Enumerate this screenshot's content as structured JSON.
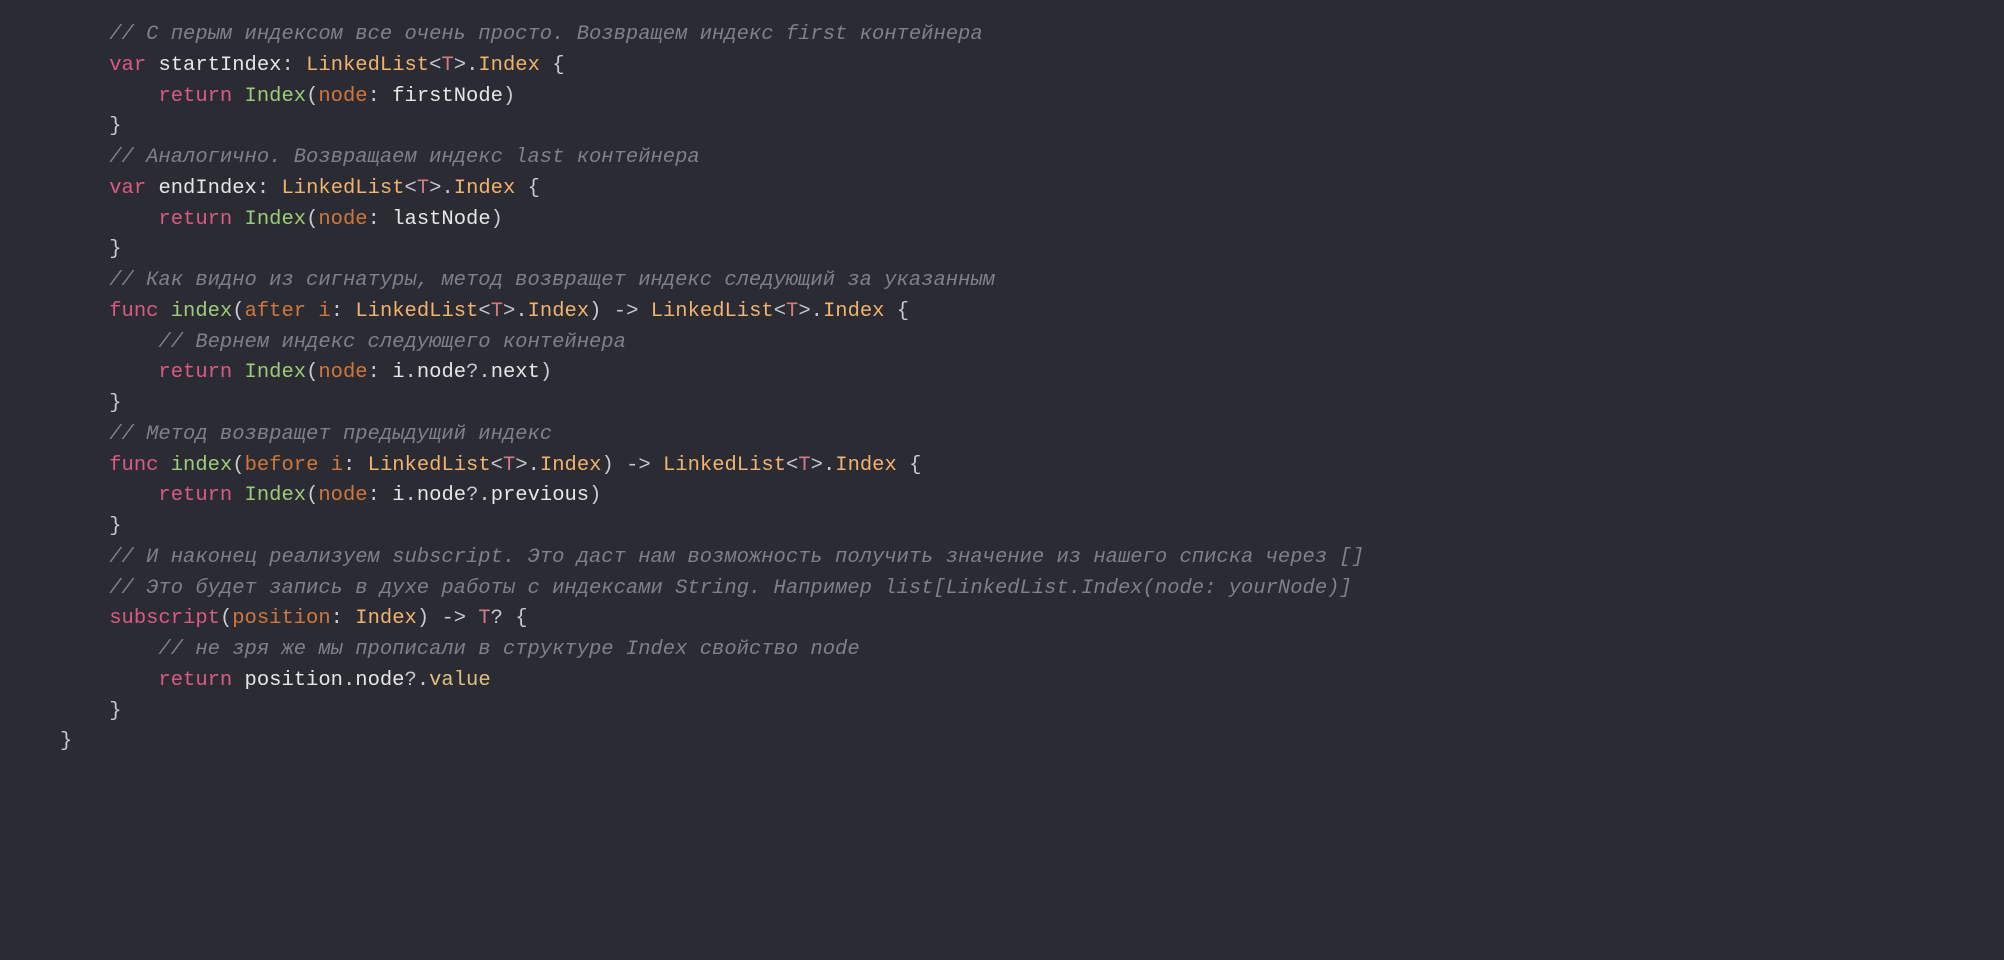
{
  "code": {
    "l1_comment": "// С перым индексом все очень просто. Возвращем индекс first контейнера",
    "l2_var": "var",
    "l2_name": "startIndex",
    "l2_colon": ":",
    "l2_type1": "LinkedList",
    "l2_lt": "<",
    "l2_T": "T",
    "l2_gt": ">",
    "l2_dot": ".",
    "l2_type2": "Index",
    "l2_brace": "{",
    "l3_return": "return",
    "l3_Index": "Index",
    "l3_open": "(",
    "l3_node": "node",
    "l3_colon": ":",
    "l3_arg": "firstNode",
    "l3_close": ")",
    "l4_brace": "}",
    "l5_comment": "// Аналогично. Возвращаем индекс last контейнера",
    "l6_var": "var",
    "l6_name": "endIndex",
    "l6_colon": ":",
    "l6_type1": "LinkedList",
    "l6_lt": "<",
    "l6_T": "T",
    "l6_gt": ">",
    "l6_dot": ".",
    "l6_type2": "Index",
    "l6_brace": "{",
    "l7_return": "return",
    "l7_Index": "Index",
    "l7_open": "(",
    "l7_node": "node",
    "l7_colon": ":",
    "l7_arg": "lastNode",
    "l7_close": ")",
    "l8_brace": "}",
    "l9_comment": "// Как видно из сигнатуры, метод возвращет индекс следующий за указанным",
    "l10_func": "func",
    "l10_name": "index",
    "l10_open": "(",
    "l10_label": "after",
    "l10_param": "i",
    "l10_colon": ":",
    "l10_type1": "LinkedList",
    "l10_lt": "<",
    "l10_T": "T",
    "l10_gt": ">",
    "l10_dot": ".",
    "l10_type2": "Index",
    "l10_close": ")",
    "l10_arrow": "->",
    "l10_rtype1": "LinkedList",
    "l10_rlt": "<",
    "l10_rT": "T",
    "l10_rgt": ">",
    "l10_rdot": ".",
    "l10_rtype2": "Index",
    "l10_brace": "{",
    "l11_comment": "// Вернем индекс следующего контейнера",
    "l12_return": "return",
    "l12_Index": "Index",
    "l12_open": "(",
    "l12_node": "node",
    "l12_colon": ":",
    "l12_i": "i",
    "l12_dot1": ".",
    "l12_noderef": "node",
    "l12_q": "?",
    "l12_dot2": ".",
    "l12_next": "next",
    "l12_close": ")",
    "l13_brace": "}",
    "l14_comment": "// Метод возвращет предыдущий индекс",
    "l15_func": "func",
    "l15_name": "index",
    "l15_open": "(",
    "l15_label": "before",
    "l15_param": "i",
    "l15_colon": ":",
    "l15_type1": "LinkedList",
    "l15_lt": "<",
    "l15_T": "T",
    "l15_gt": ">",
    "l15_dot": ".",
    "l15_type2": "Index",
    "l15_close": ")",
    "l15_arrow": "->",
    "l15_rtype1": "LinkedList",
    "l15_rlt": "<",
    "l15_rT": "T",
    "l15_rgt": ">",
    "l15_rdot": ".",
    "l15_rtype2": "Index",
    "l15_brace": "{",
    "l16_return": "return",
    "l16_Index": "Index",
    "l16_open": "(",
    "l16_node": "node",
    "l16_colon": ":",
    "l16_i": "i",
    "l16_dot1": ".",
    "l16_noderef": "node",
    "l16_q": "?",
    "l16_dot2": ".",
    "l16_prev": "previous",
    "l16_close": ")",
    "l17_brace": "}",
    "l18_comment": "// И наконец реализуем subscript. Это даст нам возможность получить значение из нашего списка через []",
    "l19_comment": "// Это будет запись в духе работы с индексами String. Например list[LinkedList.Index(node: yourNode)]",
    "l20_sub": "subscript",
    "l20_open": "(",
    "l20_param": "position",
    "l20_colon": ":",
    "l20_type": "Index",
    "l20_close": ")",
    "l20_arrow": "->",
    "l20_rtype": "T",
    "l20_q": "?",
    "l20_brace": "{",
    "l21_comment": "// не зря же мы прописали в структуре Index свойство node",
    "l22_return": "return",
    "l22_pos": "position",
    "l22_dot1": ".",
    "l22_node": "node",
    "l22_q": "?",
    "l22_dot2": ".",
    "l22_value": "value",
    "l23_brace": "}",
    "l24_brace": "}"
  }
}
